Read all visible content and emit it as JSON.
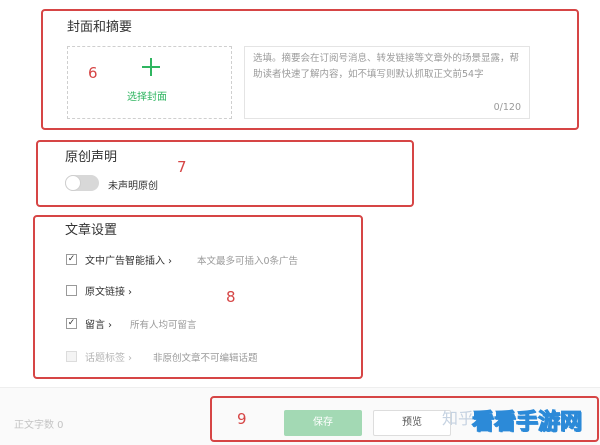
{
  "cover": {
    "title": "封面和摘要",
    "select_label": "选择封面",
    "summary_placeholder": "选填。摘要会在订阅号消息、转发链接等文章外的场景显露，帮助读者快速了解内容，如不填写则默认抓取正文前54字",
    "summary_counter": "0/120"
  },
  "original": {
    "title": "原创声明",
    "toggle_label": "未声明原创",
    "toggle_on": false
  },
  "settings": {
    "title": "文章设置",
    "options": [
      {
        "label": "文中广告智能插入",
        "desc": "本文最多可插入0条广告",
        "checked": true,
        "disabled": false,
        "check_mark": "✓"
      },
      {
        "label": "原文链接",
        "desc": "",
        "checked": false,
        "disabled": false,
        "check_mark": ""
      },
      {
        "label": "留言",
        "desc": "所有人均可留言",
        "checked": true,
        "disabled": false,
        "check_mark": "✓"
      },
      {
        "label": "话题标签",
        "desc": "非原创文章不可编辑话题",
        "checked": false,
        "disabled": true,
        "check_mark": ""
      }
    ]
  },
  "bottom": {
    "wordcount": "正文字数 0",
    "save": "保存",
    "preview": "预览"
  },
  "annotations": {
    "n6": "6",
    "n7": "7",
    "n8": "8",
    "n9": "9",
    "color": "#d64545"
  },
  "watermark": {
    "zhihu": "知乎",
    "site": "看看手游网"
  },
  "accent_color": "#2fb560"
}
